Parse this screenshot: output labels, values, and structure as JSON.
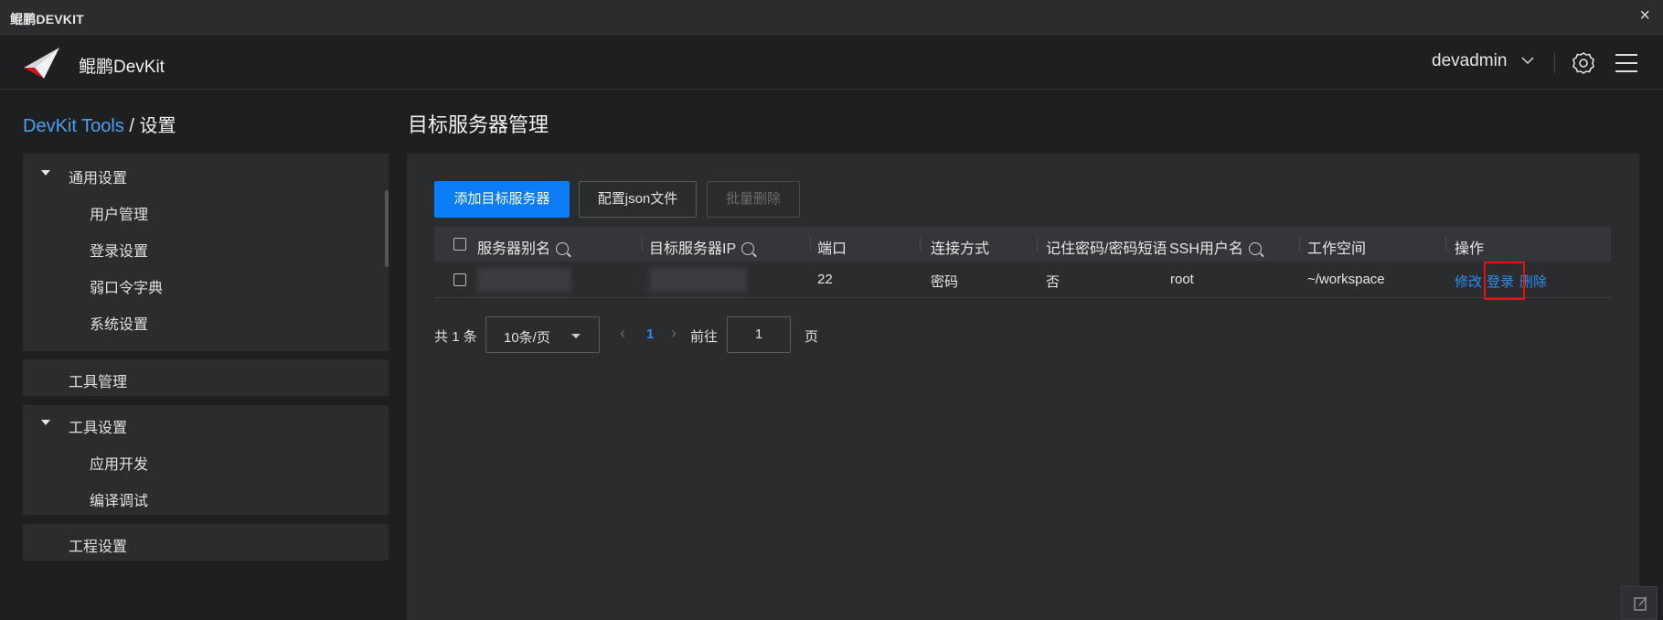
{
  "window": {
    "title": "鲲鹏DEVKIT",
    "close_glyph": "×"
  },
  "header": {
    "brand": "鲲鹏DevKit",
    "username": "devadmin",
    "icons": [
      "logo-icon",
      "chevron-down-icon",
      "gear-icon",
      "hamburger-menu-icon"
    ]
  },
  "breadcrumb": {
    "link": "DevKit Tools",
    "separator": "/",
    "current": "设置"
  },
  "page_title": "目标服务器管理",
  "sidebar": {
    "general": {
      "label": "通用设置",
      "items": [
        "用户管理",
        "登录设置",
        "弱口令字典",
        "系统设置"
      ]
    },
    "tool_management": {
      "label": "工具管理"
    },
    "tool_settings": {
      "label": "工具设置",
      "items": [
        "应用开发",
        "编译调试"
      ]
    },
    "project_settings": {
      "label": "工程设置"
    }
  },
  "toolbar": {
    "add_label": "添加目标服务器",
    "config_label": "配置json文件",
    "batch_delete_label": "批量删除"
  },
  "table": {
    "columns": [
      "服务器别名",
      "目标服务器IP",
      "端口",
      "连接方式",
      "记住密码/密码短语",
      "SSH用户名",
      "工作空间",
      "操作"
    ],
    "rows": [
      {
        "alias": "",
        "ip": "",
        "port": "22",
        "connection": "密码",
        "remember": "否",
        "ssh_user": "root",
        "workspace": "~/workspace",
        "actions": {
          "edit": "修改",
          "login": "登录",
          "delete": "删除"
        }
      }
    ]
  },
  "pagination": {
    "total_prefix": "共",
    "total": "1",
    "total_suffix": "条",
    "page_size": "10条/页",
    "prev": "‹",
    "current_page": "1",
    "next": "›",
    "goto_label": "前往",
    "goto_value": "1",
    "goto_suffix": "页"
  },
  "colors": {
    "accent": "#0a7cf6",
    "link": "#4d9ef2",
    "highlight": "#e81010"
  }
}
